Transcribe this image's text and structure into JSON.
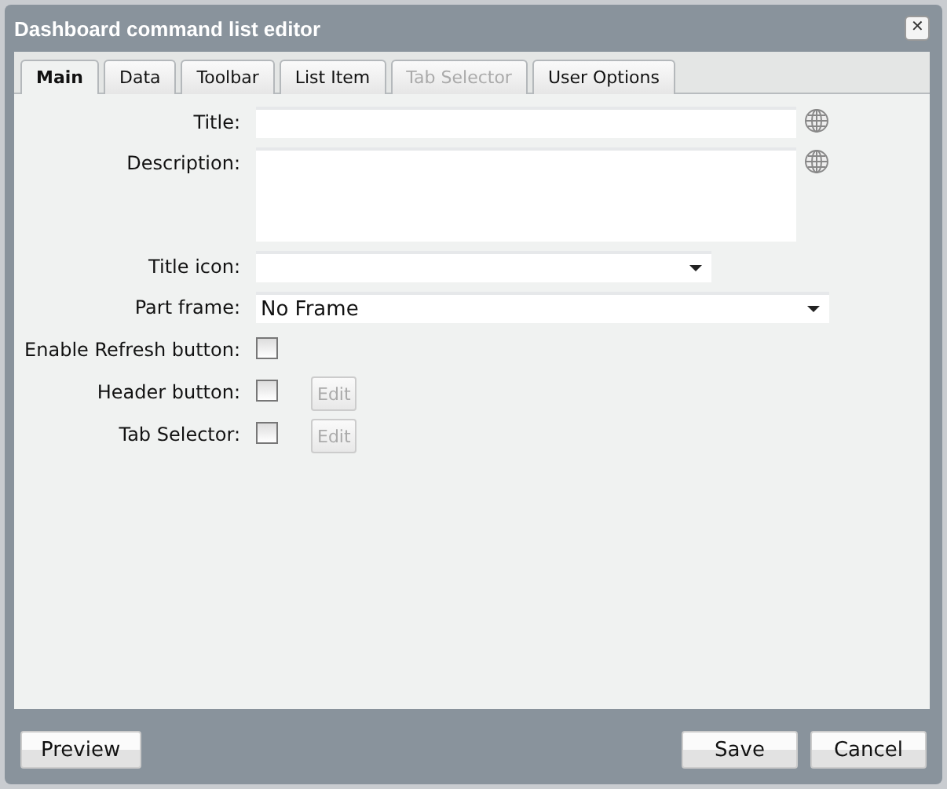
{
  "window": {
    "title": "Dashboard command list editor",
    "close": "✕"
  },
  "tabs": [
    {
      "label": "Main",
      "selected": true,
      "disabled": false
    },
    {
      "label": "Data",
      "selected": false,
      "disabled": false
    },
    {
      "label": "Toolbar",
      "selected": false,
      "disabled": false
    },
    {
      "label": "List Item",
      "selected": false,
      "disabled": false
    },
    {
      "label": "Tab Selector",
      "selected": false,
      "disabled": true
    },
    {
      "label": "User Options",
      "selected": false,
      "disabled": false
    }
  ],
  "fields": [
    {
      "kind": "text",
      "label": "Title:"
    },
    {
      "kind": "textarea",
      "label": "Description:"
    },
    {
      "kind": "icon_select",
      "label": "Title icon:"
    },
    {
      "kind": "select",
      "label": "Part frame:",
      "value": "No Frame"
    },
    {
      "kind": "checkbox",
      "label": "Enable Refresh button:",
      "checked": false
    },
    {
      "kind": "checkbox",
      "label": "Header button:",
      "checked": false,
      "button": {
        "label": "Edit",
        "disabled": true
      }
    },
    {
      "kind": "checkbox",
      "label": "Tab Selector:",
      "checked": false,
      "button": {
        "label": "Edit",
        "disabled": true
      }
    }
  ],
  "footer": {
    "left": [
      "Preview"
    ],
    "right": [
      "Save",
      "Cancel"
    ]
  }
}
